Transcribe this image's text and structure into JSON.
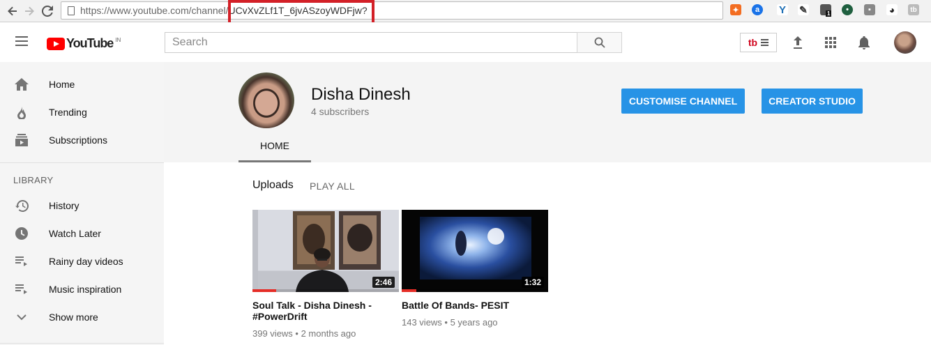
{
  "browser": {
    "url_base": "https://www.youtube.com/channel/",
    "url_id": "UCvXvZLf1T_6jvASzoyWDFjw?",
    "extension_badge": "1",
    "extension_tb_label": "tb"
  },
  "header": {
    "logo_word": "YouTube",
    "logo_region": "IN",
    "search_placeholder": "Search",
    "tb_label": "tb"
  },
  "sidebar": {
    "items": [
      {
        "label": "Home",
        "icon": "home-icon"
      },
      {
        "label": "Trending",
        "icon": "flame-icon"
      },
      {
        "label": "Subscriptions",
        "icon": "subscriptions-icon"
      }
    ],
    "library_title": "LIBRARY",
    "library_items": [
      {
        "label": "History",
        "icon": "history-icon"
      },
      {
        "label": "Watch Later",
        "icon": "clock-icon"
      },
      {
        "label": "Rainy day videos",
        "icon": "playlist-icon"
      },
      {
        "label": "Music inspiration",
        "icon": "playlist-icon"
      },
      {
        "label": "Show more",
        "icon": "chevron-down-icon"
      }
    ]
  },
  "channel": {
    "name": "Disha Dinesh",
    "subscribers": "4 subscribers",
    "customise_button": "CUSTOMISE CHANNEL",
    "studio_button": "CREATOR STUDIO",
    "tabs": [
      {
        "label": "HOME"
      }
    ]
  },
  "uploads": {
    "title": "Uploads",
    "play_all": "PLAY ALL",
    "videos": [
      {
        "title_line1": "Soul Talk - Disha Dinesh -",
        "title_line2": "#PowerDrift",
        "duration": "2:46",
        "views": "399 views",
        "age": "2 months ago",
        "watched_fraction": 0.16
      },
      {
        "title_line1": "Battle Of Bands- PESIT",
        "title_line2": "",
        "duration": "1:32",
        "views": "143 views",
        "age": "5 years ago",
        "watched_fraction": 0.1
      }
    ]
  },
  "colors": {
    "accent_blue": "#2793e6",
    "youtube_red": "#ff0000",
    "highlight_red": "#d32027"
  }
}
